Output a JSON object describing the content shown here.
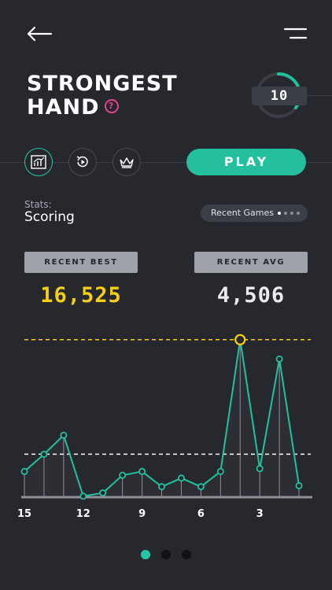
{
  "header": {
    "title_line1": "STRONGEST",
    "title_line2": "HAND",
    "help_symbol": "?",
    "level": "10",
    "back_icon": "arrow-left-icon",
    "menu_icon": "menu-icon"
  },
  "toolbar": {
    "icons": [
      "chart-icon",
      "replay-icon",
      "crown-icon"
    ],
    "play_label": "PLAY"
  },
  "stats": {
    "label": "Stats:",
    "value": "Scoring",
    "recent_games_label": "Recent Games"
  },
  "cards": {
    "best_label": "RECENT BEST",
    "best_value": "16,525",
    "avg_label": "RECENT AVG",
    "avg_value": "4,506"
  },
  "colors": {
    "accent": "#24bf9f",
    "best": "#f5d015",
    "background": "#26282e",
    "help": "#e8418f"
  },
  "chart_data": {
    "type": "line",
    "x": [
      15,
      14,
      13,
      12,
      11,
      10,
      9,
      8,
      7,
      6,
      5,
      4,
      3,
      2,
      1
    ],
    "xticks": [
      15,
      12,
      9,
      6,
      3
    ],
    "values": [
      2700,
      4500,
      6500,
      100,
      450,
      2300,
      2700,
      1100,
      2000,
      1100,
      2700,
      16525,
      3000,
      14500,
      1200
    ],
    "best": 16525,
    "average": 4506,
    "ylim": [
      0,
      17500
    ],
    "xlim": [
      15,
      0.4
    ]
  }
}
